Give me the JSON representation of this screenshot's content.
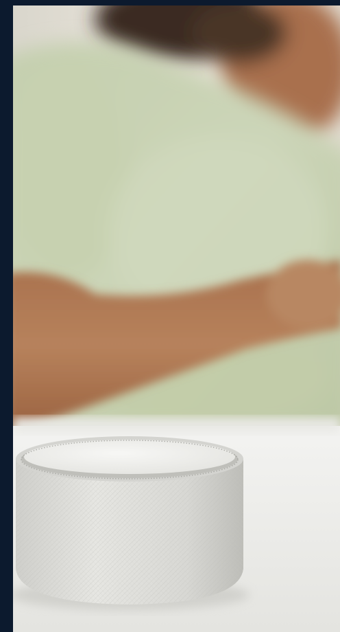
{
  "page": {
    "background_color": "#0c1a2e"
  },
  "photo": {
    "subject": "smart-speaker-on-table",
    "colors": {
      "shirt": "#c9d2b4",
      "skin": "#b07a55",
      "hair": "#3a2a20",
      "wall": "#ece7de",
      "table": "#efefec",
      "speaker": "#dcdcd8"
    }
  }
}
